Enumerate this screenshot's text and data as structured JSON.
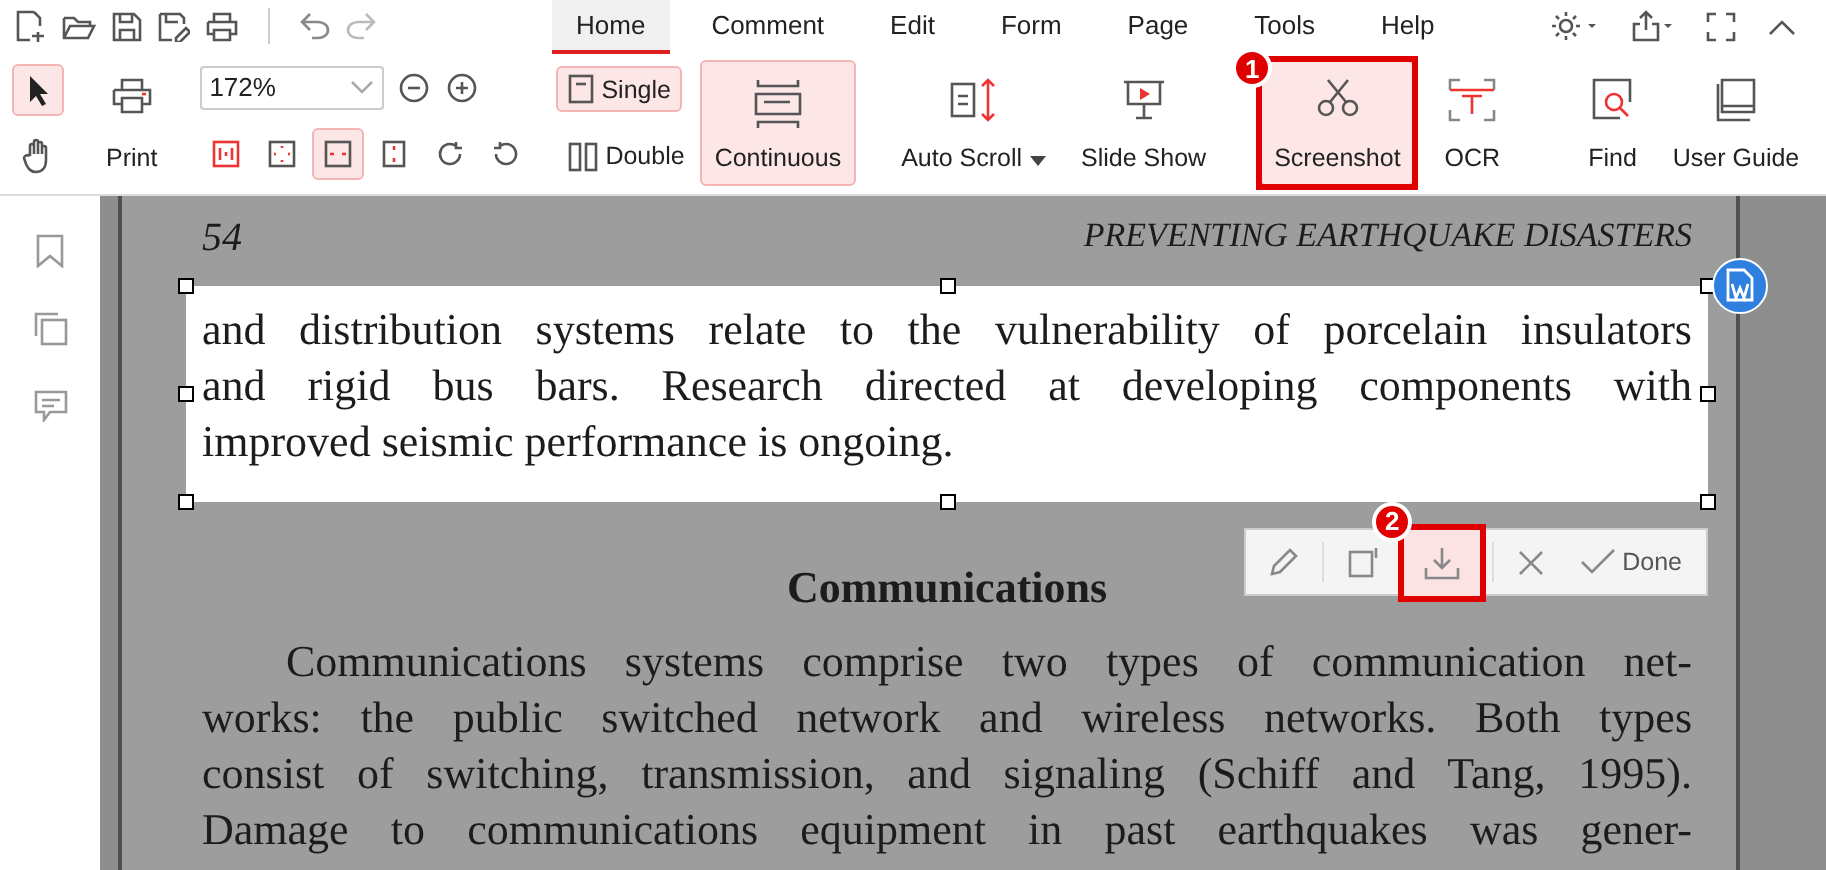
{
  "menu_tabs": [
    {
      "label": "Home",
      "selected": true
    },
    {
      "label": "Comment",
      "selected": false
    },
    {
      "label": "Edit",
      "selected": false
    },
    {
      "label": "Form",
      "selected": false
    },
    {
      "label": "Page",
      "selected": false
    },
    {
      "label": "Tools",
      "selected": false
    },
    {
      "label": "Help",
      "selected": false
    }
  ],
  "ribbon": {
    "tools": [
      {
        "kind": "select",
        "selected": true
      },
      {
        "kind": "hand",
        "selected": false
      }
    ],
    "print": {
      "label": "Print"
    },
    "zoom": {
      "value": "172%"
    },
    "fit_modes": [
      {
        "kind": "actual",
        "selected": false
      },
      {
        "kind": "page",
        "selected": false
      },
      {
        "kind": "width",
        "selected": true
      },
      {
        "kind": "height",
        "selected": false
      }
    ],
    "single": {
      "label": "Single",
      "selected": true
    },
    "double": {
      "label": "Double",
      "selected": false
    },
    "continuous": {
      "label": "Continuous",
      "selected": true
    },
    "auto_scroll": {
      "label": "Auto Scroll"
    },
    "slide_show": {
      "label": "Slide Show"
    },
    "screenshot": {
      "label": "Screenshot",
      "selected": true,
      "callout": "1"
    },
    "ocr": {
      "label": "OCR"
    },
    "find": {
      "label": "Find"
    },
    "user_guide": {
      "label": "User Guide"
    }
  },
  "document": {
    "page_number": "54",
    "running_head": "PREVENTING EARTHQUAKE DISASTERS",
    "selected_lines": [
      "and distribution systems relate to the vulnerability of porcelain insulators",
      "and rigid bus bars. Research directed at developing components with",
      "improved seismic performance is ongoing."
    ],
    "heading": "Communications",
    "body_lines": [
      "Communications systems comprise two types of communication net-",
      "works: the public switched network and wireless networks. Both types",
      "consist of switching, transmission, and signaling (Schiff and Tang, 1995).",
      "Damage to communications equipment in past earthquakes was gener-"
    ]
  },
  "capture_toolbar": {
    "done_label": "Done",
    "download_callout": "2"
  }
}
